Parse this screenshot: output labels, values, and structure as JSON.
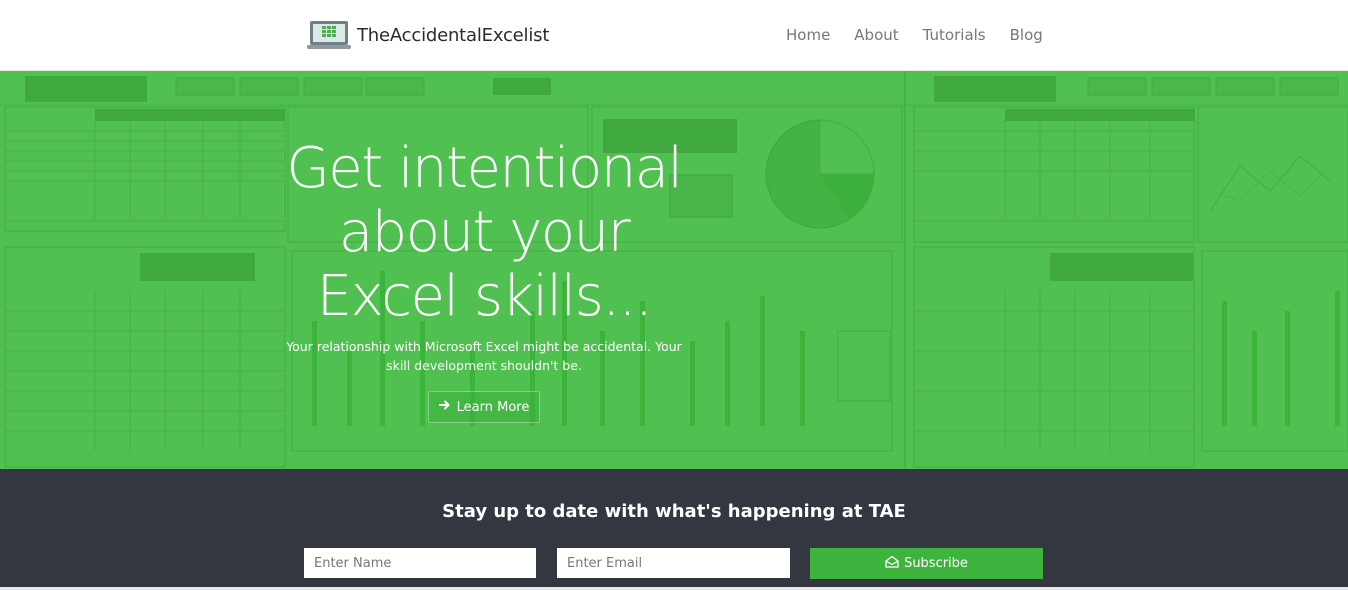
{
  "brand": {
    "name": "TheAccidentalExcelist",
    "logo_icon": "laptop-spreadsheet-icon"
  },
  "nav": {
    "items": [
      "Home",
      "About",
      "Tutorials",
      "Blog"
    ]
  },
  "hero": {
    "title_lines": [
      "Get intentional",
      "about your",
      "Excel skills..."
    ],
    "subtitle_lines": [
      "Your relationship with Microsoft Excel might be accidental. Your",
      "skill development shouldn't be."
    ],
    "button_label": "Learn More",
    "button_icon": "arrow-right-icon",
    "overlay_color": "#50c050"
  },
  "subscribe": {
    "title": "Stay up to date with what's happening at TAE",
    "name_placeholder": "Enter Name",
    "email_placeholder": "Enter Email",
    "button_label": "Subscribe",
    "button_icon": "envelope-open-icon",
    "background_color": "#353740",
    "button_color": "#3eb43e"
  }
}
